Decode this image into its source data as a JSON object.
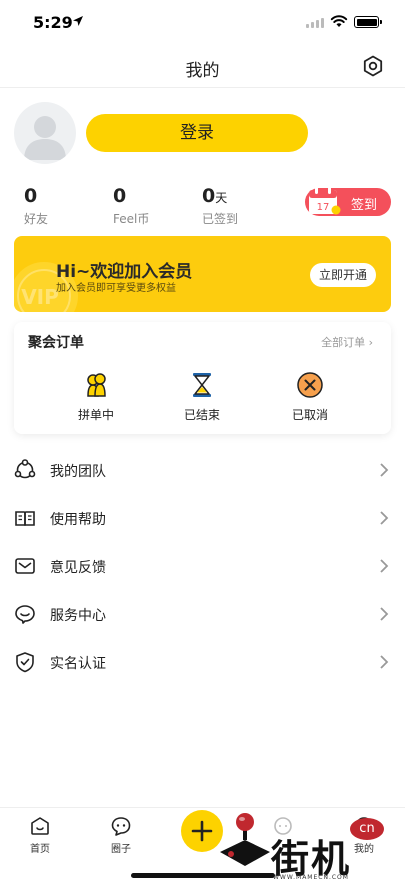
{
  "status_bar": {
    "time": "5:29"
  },
  "nav": {
    "title": "我的"
  },
  "profile": {
    "login_label": "登录"
  },
  "stats": [
    {
      "value": "0",
      "unit": "",
      "label": "好友"
    },
    {
      "value": "0",
      "unit": "",
      "label": "Feel币"
    },
    {
      "value": "0",
      "unit": "天",
      "label": "已签到"
    }
  ],
  "checkin": {
    "label": "签到",
    "calendar_day": "17"
  },
  "vip": {
    "badge": "VIP",
    "title": "Hi~欢迎加入会员",
    "subtitle": "加入会员即可享受更多权益",
    "button": "立即开通"
  },
  "orders": {
    "title": "聚会订单",
    "all_label": "全部订单 ›",
    "items": [
      {
        "label": "拼单中",
        "icon": "group-people-icon"
      },
      {
        "label": "已结束",
        "icon": "hourglass-icon"
      },
      {
        "label": "已取消",
        "icon": "cancel-circle-icon"
      }
    ]
  },
  "menu": [
    {
      "label": "我的团队",
      "icon": "team-icon"
    },
    {
      "label": "使用帮助",
      "icon": "help-book-icon"
    },
    {
      "label": "意见反馈",
      "icon": "feedback-mail-icon"
    },
    {
      "label": "服务中心",
      "icon": "service-chat-icon"
    },
    {
      "label": "实名认证",
      "icon": "shield-check-icon"
    }
  ],
  "tabs": [
    {
      "label": "首页",
      "icon": "home-icon"
    },
    {
      "label": "圈子",
      "icon": "circle-chat-icon"
    },
    {
      "label": "",
      "icon": "add-icon"
    },
    {
      "label": "",
      "icon": "message-icon"
    },
    {
      "label": "我的",
      "icon": "profile-icon"
    }
  ],
  "watermark": {
    "text": "街机",
    "badge": "cn",
    "url": "WWW.MAMECN.COM"
  },
  "colors": {
    "accent": "#fdd200",
    "checkin": "#f4505b",
    "vip": "#fdcc0e"
  }
}
